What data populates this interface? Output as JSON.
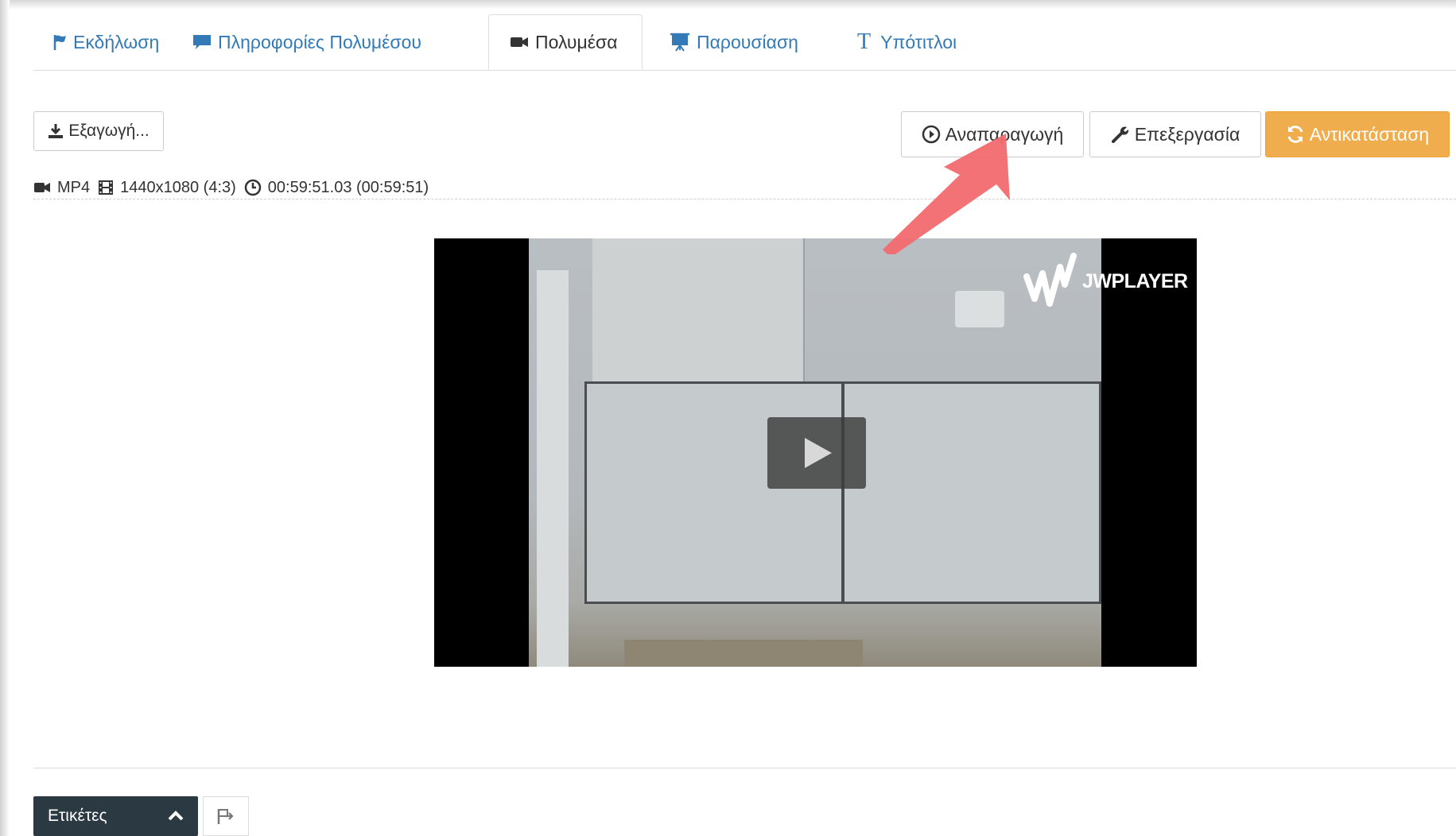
{
  "tabs": [
    {
      "label": "Εκδήλωση",
      "icon": "flag-icon"
    },
    {
      "label": "Πληροφορίες Πολυμέσου",
      "icon": "comment-icon"
    },
    {
      "label": "Πολυμέσα",
      "icon": "video-camera-icon"
    },
    {
      "label": "Παρουσίαση",
      "icon": "presentation-icon"
    },
    {
      "label": "Υπότιτλοι",
      "icon": "text-icon"
    }
  ],
  "active_tab": "Πολυμέσα",
  "toolbar": {
    "export_label": "Εξαγωγή...",
    "play_label": "Αναπαραγωγή",
    "edit_label": "Επεξεργασία",
    "replace_label": "Αντικατάσταση"
  },
  "media_info": {
    "format": "MP4",
    "resolution": "1440x1080 (4:3)",
    "duration": "00:59:51.03 (00:59:51)"
  },
  "player": {
    "brand": "JWPLAYER"
  },
  "footer": {
    "tags_label": "Ετικέτες"
  },
  "colors": {
    "link": "#337ab7",
    "warning_button": "#f0ad4e",
    "dark_button": "#2b3a42",
    "annotation_arrow": "#f26a6f"
  }
}
